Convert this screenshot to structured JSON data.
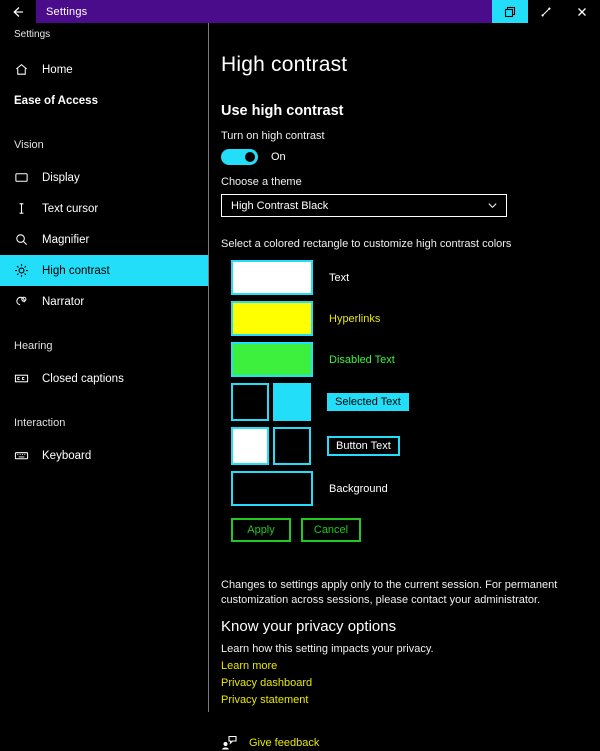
{
  "titlebar": {
    "back_icon": "back-arrow-icon",
    "title": "Settings",
    "restore_icon": "restore-window-icon",
    "minimize_icon": "minimize-window-icon",
    "close_icon": "close-window-icon"
  },
  "sidebar": {
    "app_label": "Settings",
    "home": {
      "label": "Home",
      "icon": "home-icon"
    },
    "category": "Ease of Access",
    "groups": [
      {
        "label": "Vision",
        "items": [
          {
            "label": "Display",
            "icon": "monitor-icon",
            "selected": false
          },
          {
            "label": "Text cursor",
            "icon": "text-cursor-icon",
            "selected": false
          },
          {
            "label": "Magnifier",
            "icon": "magnifier-icon",
            "selected": false
          },
          {
            "label": "High contrast",
            "icon": "brightness-icon",
            "selected": true
          },
          {
            "label": "Narrator",
            "icon": "narrator-icon",
            "selected": false
          }
        ]
      },
      {
        "label": "Hearing",
        "items": [
          {
            "label": "Closed captions",
            "icon": "closed-captions-icon",
            "selected": false
          }
        ]
      },
      {
        "label": "Interaction",
        "items": [
          {
            "label": "Keyboard",
            "icon": "keyboard-icon",
            "selected": false
          }
        ]
      }
    ]
  },
  "main": {
    "page_title": "High contrast",
    "section_title": "Use high contrast",
    "toggle_label": "Turn on high contrast",
    "toggle_state": "On",
    "theme_label": "Choose a theme",
    "theme_value": "High Contrast Black",
    "theme_chevron_icon": "chevron-down-icon",
    "swatch_helper": "Select a colored rectangle to customize high contrast colors",
    "swatches": [
      {
        "label": "Text",
        "colors": [
          "#ffffff"
        ],
        "style": "wide",
        "label_color": "#ffffff",
        "label_style": "plain"
      },
      {
        "label": "Hyperlinks",
        "colors": [
          "#FFFF00"
        ],
        "style": "wide",
        "label_color": "#E8E800",
        "label_style": "plain"
      },
      {
        "label": "Disabled Text",
        "colors": [
          "#3EF03E"
        ],
        "style": "wide",
        "label_color": "#3EF03E",
        "label_style": "plain"
      },
      {
        "label": "Selected Text",
        "colors": [
          "#000000",
          "#22DEF8"
        ],
        "style": "pair",
        "label_color": "#000000",
        "label_style": "chip"
      },
      {
        "label": "Button Text",
        "colors": [
          "#ffffff",
          "#000000"
        ],
        "style": "pair",
        "label_color": "#ffffff",
        "label_style": "boxed"
      },
      {
        "label": "Background",
        "colors": [
          "#000000"
        ],
        "style": "wide",
        "label_color": "#ffffff",
        "label_style": "plain"
      }
    ],
    "apply_label": "Apply",
    "cancel_label": "Cancel",
    "note": "Changes to settings apply only to the current session. For permanent customization across sessions, please contact your administrator.",
    "privacy_title": "Know your privacy options",
    "privacy_sub": "Learn how this setting impacts your privacy.",
    "links": [
      "Learn more",
      "Privacy dashboard",
      "Privacy statement"
    ],
    "feedback_label": "Give feedback",
    "feedback_icon": "feedback-person-icon"
  },
  "colors": {
    "accent_cyan": "#22DEF8",
    "titlebar_purple": "#4B0C8C",
    "link_yellow": "#E8E800",
    "button_green": "#22C822",
    "background": "#000000"
  }
}
